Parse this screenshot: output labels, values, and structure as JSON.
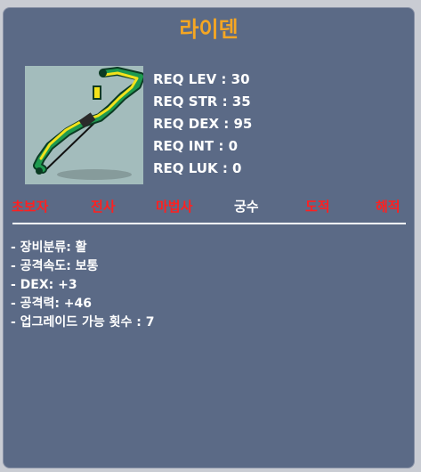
{
  "item": {
    "name": "라이덴",
    "icon": "bow-weapon-icon",
    "colors": {
      "title": "#f5a623",
      "panel": "#5b6a86",
      "unavailable_class": "#ff2020",
      "available_class": "#ffffff"
    }
  },
  "requirements": [
    {
      "label": "REQ LEV : 30"
    },
    {
      "label": "REQ STR : 35"
    },
    {
      "label": "REQ DEX : 95"
    },
    {
      "label": "REQ INT : 0"
    },
    {
      "label": "REQ LUK : 0"
    }
  ],
  "classes": [
    {
      "label": "초보자",
      "available": false
    },
    {
      "label": "전사",
      "available": false
    },
    {
      "label": "마법사",
      "available": false
    },
    {
      "label": "궁수",
      "available": true
    },
    {
      "label": "도적",
      "available": false
    },
    {
      "label": "해적",
      "available": false
    }
  ],
  "stats": [
    {
      "text": "- 장비분류: 활"
    },
    {
      "text": "- 공격속도: 보통"
    },
    {
      "text": "- DEX: +3"
    },
    {
      "text": "- 공격력: +46"
    },
    {
      "text": "- 업그레이드 가능 횟수 : 7"
    }
  ]
}
